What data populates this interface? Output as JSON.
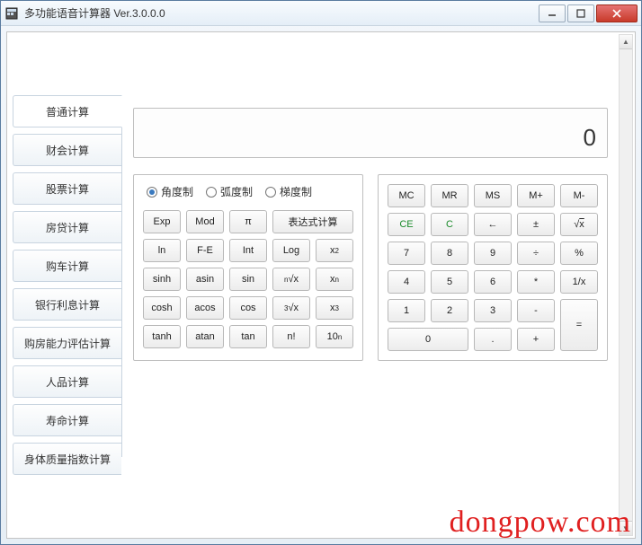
{
  "window": {
    "title": "多功能语音计算器 Ver.3.0.0.0"
  },
  "tabs": [
    {
      "label": "普通计算",
      "active": true
    },
    {
      "label": "财会计算"
    },
    {
      "label": "股票计算"
    },
    {
      "label": "房贷计算"
    },
    {
      "label": "购车计算"
    },
    {
      "label": "银行利息计算"
    },
    {
      "label": "购房能力评估计算"
    },
    {
      "label": "人品计算"
    },
    {
      "label": "寿命计算"
    },
    {
      "label": "身体质量指数计算"
    }
  ],
  "display": {
    "value": "0"
  },
  "angle_modes": [
    {
      "label": "角度制",
      "checked": true
    },
    {
      "label": "弧度制",
      "checked": false
    },
    {
      "label": "梯度制",
      "checked": false
    }
  ],
  "sci_rows": [
    [
      "Exp",
      "Mod",
      "π",
      "表达式计算"
    ],
    [
      "ln",
      "F-E",
      "Int",
      "Log",
      "x²"
    ],
    [
      "sinh",
      "asin",
      "sin",
      "ⁿ√x",
      "xⁿ"
    ],
    [
      "cosh",
      "acos",
      "cos",
      "³√x",
      "x³"
    ],
    [
      "tanh",
      "atan",
      "tan",
      "n!",
      "10ⁿ"
    ]
  ],
  "num_rows": [
    [
      "MC",
      "MR",
      "MS",
      "M+",
      "M-"
    ],
    [
      "CE",
      "C",
      "←",
      "±",
      "√x"
    ],
    [
      "7",
      "8",
      "9",
      "÷",
      "%"
    ],
    [
      "4",
      "5",
      "6",
      "*",
      "1/x"
    ],
    [
      "1",
      "2",
      "3",
      "-",
      "="
    ],
    [
      "0",
      ".",
      "+"
    ]
  ],
  "watermark": "dongpow.com"
}
